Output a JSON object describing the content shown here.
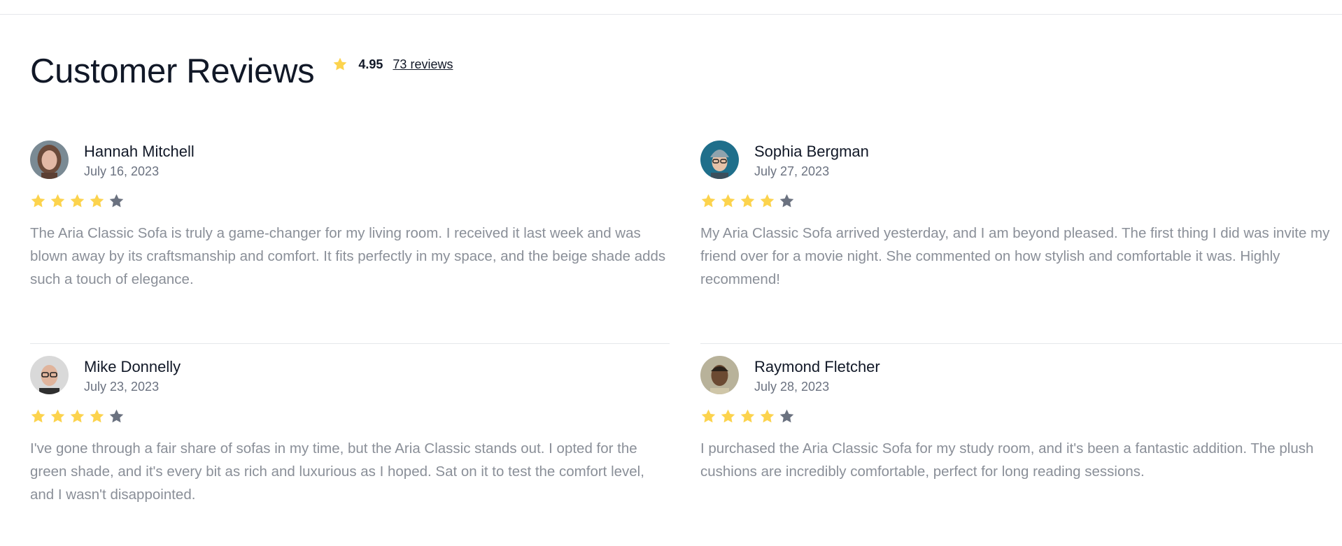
{
  "section": {
    "title": "Customer Reviews",
    "average_rating": "4.95",
    "reviews_link": "73 reviews",
    "star_color": "#fcd34d",
    "empty_star_color": "#6b7280"
  },
  "reviews": [
    {
      "name": "Hannah Mitchell",
      "date": "July 16, 2023",
      "rating": 4,
      "max_rating": 5,
      "avatar_icon": "avatar-woman",
      "text": "The Aria Classic Sofa is truly a game-changer for my living room. I received it last week and was blown away by its craftsmanship and comfort. It fits perfectly in my space, and the beige shade adds such a touch of elegance."
    },
    {
      "name": "Sophia Bergman",
      "date": "July 27, 2023",
      "rating": 4,
      "max_rating": 5,
      "avatar_icon": "avatar-woman-beanie",
      "text": "My Aria Classic Sofa arrived yesterday, and I am beyond pleased. The first thing I did was invite my friend over for a movie night. She commented on how stylish and comfortable it was. Highly recommend!"
    },
    {
      "name": "Mike Donnelly",
      "date": "July 23, 2023",
      "rating": 4,
      "max_rating": 5,
      "avatar_icon": "avatar-man-glasses",
      "text": "I've gone through a fair share of sofas in my time, but the Aria Classic stands out. I opted for the green shade, and it's every bit as rich and luxurious as I hoped. Sat on it to test the comfort level, and I wasn't disappointed."
    },
    {
      "name": "Raymond Fletcher",
      "date": "July 28, 2023",
      "rating": 4,
      "max_rating": 5,
      "avatar_icon": "avatar-man",
      "text": "I purchased the Aria Classic Sofa for my study room, and it's been a fantastic addition. The plush cushions are incredibly comfortable, perfect for long reading sessions."
    }
  ]
}
